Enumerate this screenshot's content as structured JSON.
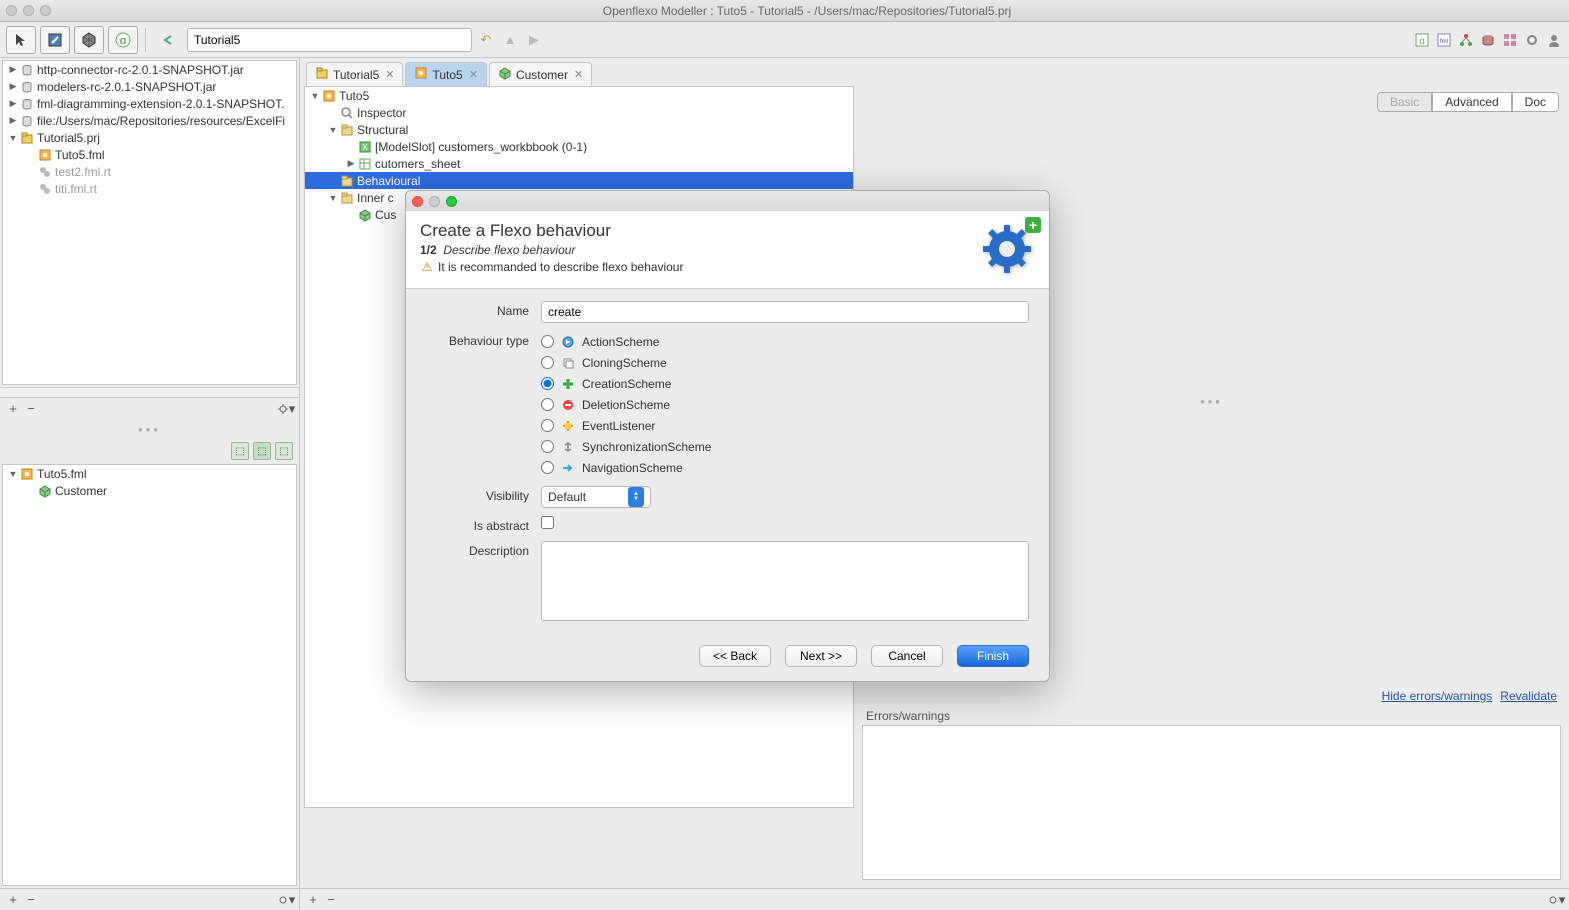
{
  "window": {
    "title": "Openflexo Modeller : Tuto5 - Tutorial5 - /Users/mac/Repositories/Tutorial5.prj"
  },
  "toolbar": {
    "search_value": "Tutorial5"
  },
  "projects_tree": {
    "items": [
      {
        "label": "http-connector-rc-2.0.1-SNAPSHOT.jar",
        "indent": 0,
        "chev": "▶",
        "type": "jar"
      },
      {
        "label": "modelers-rc-2.0.1-SNAPSHOT.jar",
        "indent": 0,
        "chev": "▶",
        "type": "jar"
      },
      {
        "label": "fml-diagramming-extension-2.0.1-SNAPSHOT.",
        "indent": 0,
        "chev": "▶",
        "type": "jar"
      },
      {
        "label": "file:/Users/mac/Repositories/resources/ExcelFi",
        "indent": 0,
        "chev": "▶",
        "type": "jar"
      },
      {
        "label": "Tutorial5.prj",
        "indent": 0,
        "chev": "▼",
        "type": "prj"
      },
      {
        "label": "Tuto5.fml",
        "indent": 1,
        "chev": "",
        "type": "fml"
      },
      {
        "label": "test2.fml.rt",
        "indent": 1,
        "chev": "",
        "type": "rt",
        "dim": true
      },
      {
        "label": "titi.fml.rt",
        "indent": 1,
        "chev": "",
        "type": "rt",
        "dim": true
      }
    ]
  },
  "outline_tree": {
    "items": [
      {
        "label": "Tuto5.fml",
        "indent": 0,
        "chev": "▼",
        "type": "fml"
      },
      {
        "label": "Customer",
        "indent": 1,
        "chev": "",
        "type": "cube"
      }
    ]
  },
  "editor_tabs": [
    {
      "label": "Tutorial5",
      "icon": "prj",
      "active": false
    },
    {
      "label": "Tuto5",
      "icon": "fml",
      "active": true
    },
    {
      "label": "Customer",
      "icon": "cube",
      "active": false
    }
  ],
  "editor_tree": {
    "items": [
      {
        "label": "Tuto5",
        "indent": 0,
        "chev": "▼",
        "type": "fml"
      },
      {
        "label": "Inspector",
        "indent": 1,
        "chev": "",
        "type": "inspector"
      },
      {
        "label": "Structural",
        "indent": 1,
        "chev": "▼",
        "type": "folder"
      },
      {
        "label": "[ModelSlot] customers_workbbook (0-1)",
        "indent": 2,
        "chev": "",
        "type": "model"
      },
      {
        "label": "cutomers_sheet",
        "indent": 2,
        "chev": "▶",
        "type": "sheet"
      },
      {
        "label": "Behavioural",
        "indent": 1,
        "chev": "",
        "type": "folder",
        "selected": true
      },
      {
        "label": "Inner c",
        "indent": 1,
        "chev": "▼",
        "type": "folder"
      },
      {
        "label": "Cus",
        "indent": 2,
        "chev": "",
        "type": "cube"
      }
    ]
  },
  "inspector": {
    "tabs": [
      "Basic",
      "Advanced",
      "Doc"
    ],
    "selected": "Basic",
    "hide_link": "Hide errors/warnings",
    "revalidate_link": "Revalidate",
    "errors_label": "Errors/warnings"
  },
  "dialog": {
    "title": "Create a Flexo behaviour",
    "step": "1/2",
    "step_desc": "Describe flexo behaviour",
    "warning": "It is recommanded to describe flexo behaviour",
    "labels": {
      "name": "Name",
      "behaviour_type": "Behaviour type",
      "visibility": "Visibility",
      "is_abstract": "Is abstract",
      "description": "Description"
    },
    "name_value": "create",
    "behaviour_types": [
      "ActionScheme",
      "CloningScheme",
      "CreationScheme",
      "DeletionScheme",
      "EventListener",
      "SynchronizationScheme",
      "NavigationScheme"
    ],
    "behaviour_selected": "CreationScheme",
    "visibility_value": "Default",
    "buttons": {
      "back": "<< Back",
      "next": "Next >>",
      "cancel": "Cancel",
      "finish": "Finish"
    }
  }
}
